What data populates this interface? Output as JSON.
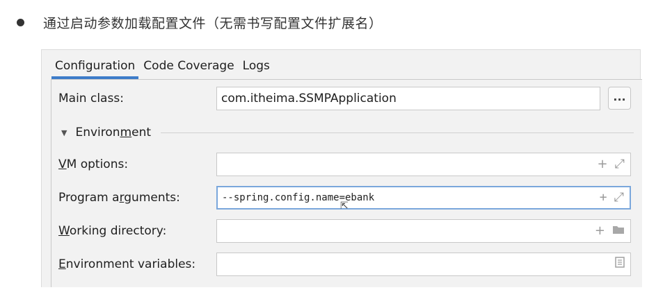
{
  "heading": {
    "text": "通过启动参数加载配置文件（无需书写配置文件扩展名）"
  },
  "tabs": [
    {
      "label": "Configuration",
      "active": true
    },
    {
      "label": "Code Coverage",
      "active": false
    },
    {
      "label": "Logs",
      "active": false
    }
  ],
  "main_class": {
    "label": "Main class:",
    "value": "com.itheima.SSMPApplication",
    "browse_label": "..."
  },
  "environment": {
    "label_pre": "Environ",
    "label_mn": "m",
    "label_post": "ent"
  },
  "vm_options": {
    "label_pre": "",
    "label_mn": "V",
    "label_post": "M options:",
    "value": ""
  },
  "program_arguments": {
    "label_pre": "Program a",
    "label_mn": "r",
    "label_post": "guments:",
    "value": "--spring.config.name=ebank"
  },
  "working_directory": {
    "label_pre": "",
    "label_mn": "W",
    "label_post": "orking directory:",
    "value": ""
  },
  "environment_variables": {
    "label_pre": "",
    "label_mn": "E",
    "label_post": "nvironment variables:",
    "value": ""
  },
  "icons": {
    "add": "plus-icon",
    "expand": "expand-icon",
    "folder": "folder-icon",
    "document": "document-icon"
  }
}
